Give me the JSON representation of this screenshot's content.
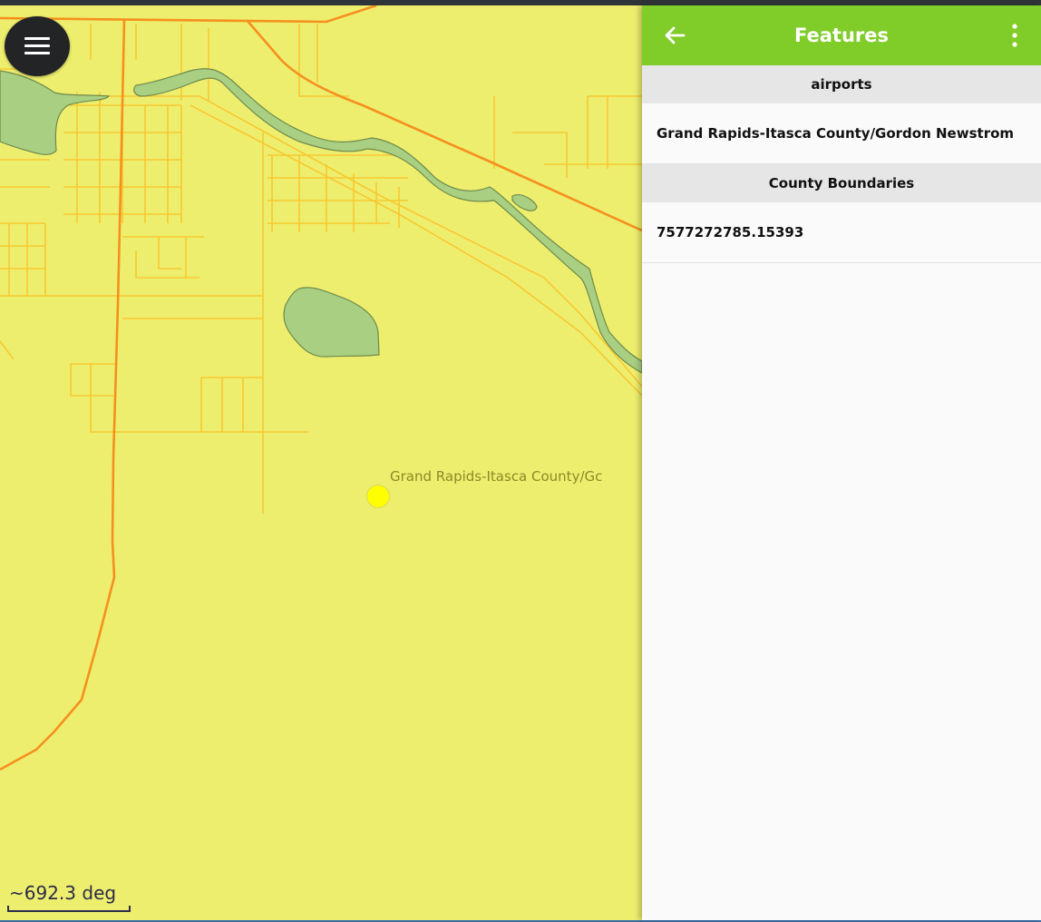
{
  "map": {
    "menu_icon": "hamburger-icon",
    "airport_label": "Grand Rapids-Itasca County/Gc",
    "scale_text": "~692.3 deg",
    "colors": {
      "land": "#eeee6e",
      "water": "#a8cf82",
      "major_road": "#f5901e",
      "minor_road": "#f7c830",
      "airport": "#ffff00"
    }
  },
  "panel": {
    "title": "Features",
    "back_icon": "arrow-left-icon",
    "more_icon": "more-vertical-icon",
    "header_color": "#80cc28",
    "sections": [
      {
        "label": "airports",
        "items": [
          "Grand Rapids-Itasca County/Gordon Newstrom"
        ]
      },
      {
        "label": "County Boundaries",
        "items": [
          "7577272785.15393"
        ]
      }
    ]
  }
}
